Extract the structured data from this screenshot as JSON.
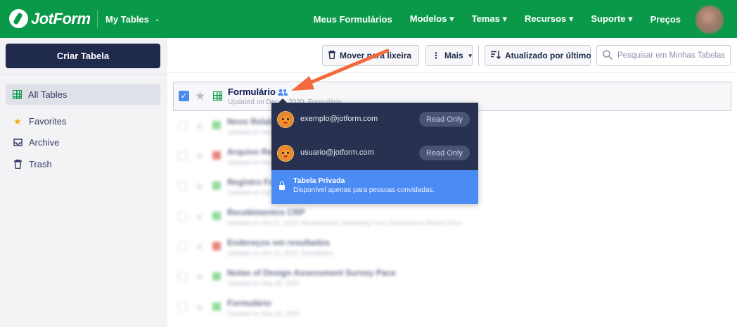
{
  "header": {
    "logo_text": "JotForm",
    "app_switcher": "My Tables",
    "nav": [
      "Meus Formulários",
      "Modelos ▾",
      "Temas ▾",
      "Recursos ▾",
      "Suporte ▾",
      "Preços"
    ]
  },
  "sidebar": {
    "create_button": "Criar Tabela",
    "items": [
      {
        "label": "All Tables",
        "icon": "table-grid-icon",
        "active": true
      },
      {
        "label": "Favorites",
        "icon": "star-icon"
      },
      {
        "label": "Archive",
        "icon": "archive-icon"
      },
      {
        "label": "Trash",
        "icon": "trash-icon"
      }
    ]
  },
  "toolbar": {
    "trash_label": "Mover para lixeira",
    "more_label": "Mais",
    "sort_label": "Atualizado por último",
    "search_placeholder": "Pesquisar em Minhas Tabelas"
  },
  "selected_row": {
    "title": "Formulário",
    "subtitle": "Updated on Dec 2, 2020, Formulário"
  },
  "share_popup": {
    "users": [
      {
        "email": "exemplo@jotform.com",
        "permission": "Read Only"
      },
      {
        "email": "usuario@jotform.com",
        "permission": "Read Only"
      }
    ],
    "private_title": "Tabela Privada",
    "private_desc": "Disponível apenas para pessoas convidadas."
  },
  "colors": {
    "header_green": "#0a9948",
    "accent_blue": "#4b8bf4",
    "popup_dark": "#293150",
    "arrow_orange": "#f26a3d"
  }
}
